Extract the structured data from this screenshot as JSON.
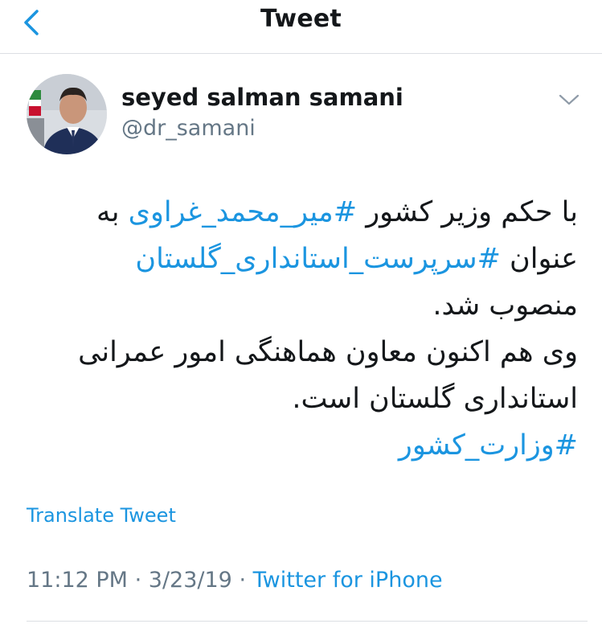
{
  "header": {
    "title": "Tweet"
  },
  "tweet": {
    "author_name": "seyed salman samani",
    "author_handle": "@dr_samani",
    "lines": [
      {
        "before": "با حکم وزیر کشور ",
        "tag": "#میر_محمد_غراوی",
        "after": " به"
      },
      {
        "before": "عنوان ",
        "tag": "#سرپرست_استانداری_گلستان",
        "after": ""
      },
      {
        "text": "منصوب شد."
      },
      {
        "text": "وی هم اکنون معاون هماهنگی امور عمرانی"
      },
      {
        "text": "استانداری گلستان است."
      },
      {
        "tag": "#وزارت_کشور"
      }
    ],
    "translate_label": "Translate Tweet",
    "time": "11:12 PM",
    "date": "3/23/19",
    "separator": "·",
    "source": "Twitter for iPhone"
  },
  "colors": {
    "accent": "#1b95e0",
    "muted": "#657786",
    "text": "#14171a"
  },
  "icons": {
    "back": "chevron-left-icon",
    "menu": "chevron-down-icon"
  }
}
